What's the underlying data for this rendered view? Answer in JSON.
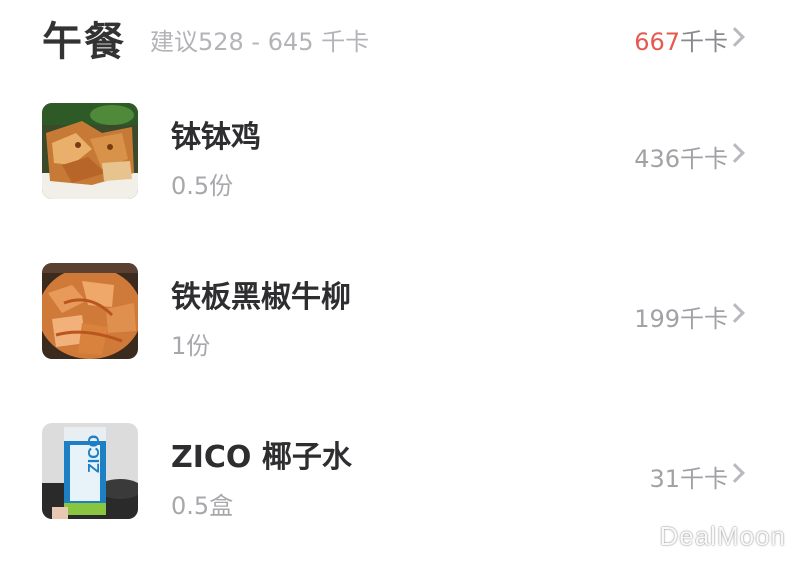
{
  "meal": {
    "title": "午餐",
    "suggestion": "建议528 - 645 千卡",
    "total_value": "667",
    "total_unit": "千卡"
  },
  "foods": [
    {
      "name": "钵钵鸡",
      "amount": "0.5份",
      "calories": "436千卡",
      "image_icon": "fried-chicken-photo"
    },
    {
      "name": "铁板黑椒牛柳",
      "amount": "1份",
      "calories": "199千卡",
      "image_icon": "beef-sizzling-plate-photo"
    },
    {
      "name": "ZICO 椰子水",
      "amount": "0.5盒",
      "calories": "31千卡",
      "image_icon": "coconut-water-carton-photo"
    }
  ],
  "watermark": "DealMoon"
}
